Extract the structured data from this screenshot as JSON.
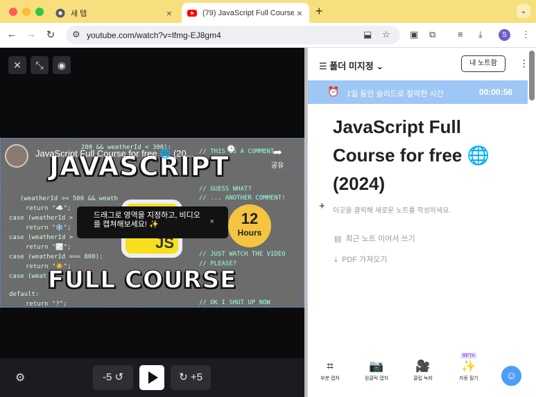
{
  "browser": {
    "tabs": [
      {
        "title": "새 탭",
        "active": false
      },
      {
        "title": "(79) JavaScript Full Course fo",
        "active": true
      }
    ],
    "new_tab": "+",
    "url": "youtube.com/watch?v=lfmg-EJ8gm4",
    "profile_initial": "S"
  },
  "video": {
    "overlay_title": "JavaScript Full Course for free 🌐 (20...",
    "share_label": "공유",
    "code_lines": [
      "200 && weatherId < 300):",
      "(weatherId >= 500 && weath",
      "return \"☁️\";",
      "case (weatherId >",
      "return \"❄️\";",
      "case (weatherId >",
      "return \"🌫️\";",
      "case (weatherId === 800):",
      "return \"☀️\";",
      "case (weat",
      "default:",
      "return \"?\";"
    ],
    "comments": [
      "// THIS IS A COMMENT",
      "// GUESS WHAT?",
      "// ... ANOTHER COMMENT!",
      "// JUST WATCH THE VIDEO",
      "// PLEASE?",
      "// OK I SHUT UP NOW"
    ],
    "thumb_title_top": "JAVASCRIPT",
    "thumb_title_bottom": "FULL COURSE",
    "logo_text": "JS",
    "badge_number": "12",
    "badge_label": "Hours",
    "tooltip_line1": "드래그로 영역을 지정하고, 비디오",
    "tooltip_line2": "를 캡쳐해보세요! ✨",
    "tooltip_close": "×",
    "back_label": "-5",
    "forward_label": "+5"
  },
  "panel": {
    "folder_label": "폴더 미지정",
    "my_notes_button": "내 노트함",
    "banner_text": "1일 동안 슬리드로 절약한 시간",
    "banner_time": "00:00:56",
    "note_title": "JavaScript Full Course for free 🌐 (2024)",
    "hint": "이곳을 클릭해 새로운 노트를 작성하세요.",
    "menu": [
      "최근 노트 이어서 쓰기",
      "PDF 가져오기"
    ],
    "tools": [
      "부분 캡처",
      "원클릭 캡처",
      "클립 녹화",
      "자동 필기"
    ],
    "beta_label": "BETA"
  },
  "colors": {
    "tabbar": "#f8df7e",
    "banner": "#9fc7f5",
    "selection": "#4c8df5"
  }
}
